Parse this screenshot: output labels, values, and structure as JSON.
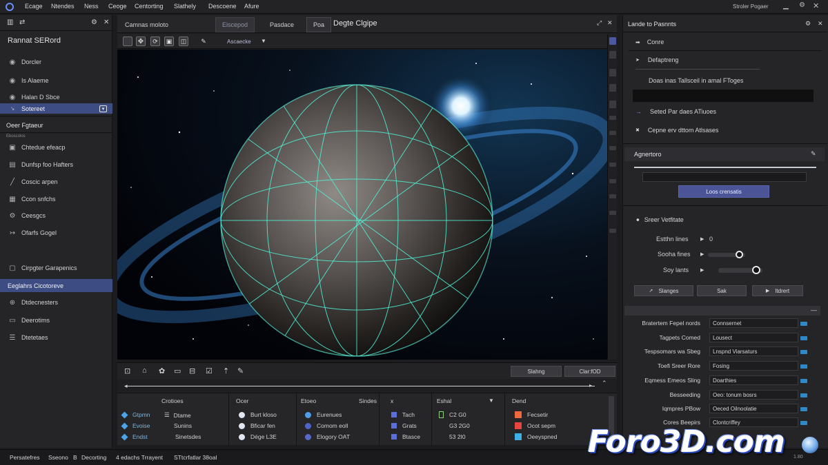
{
  "menubar": {
    "items": [
      "Ecage",
      "Ntendes",
      "Ness",
      "Ceoge",
      "Centorting",
      "Slathely",
      "Descoene",
      "Afure"
    ],
    "right_label": "Stroler Pogaer"
  },
  "left_panel": {
    "title": "Rannat SERord",
    "items_top": [
      {
        "label": "Dorcler",
        "icon": "circle-icon"
      },
      {
        "label": "Is Alaeme",
        "icon": "circle-icon"
      },
      {
        "label": "Halan D Sbce",
        "icon": "circle-icon"
      },
      {
        "label": "Sotereet",
        "icon": "expand-icon"
      }
    ],
    "section": "Oeer Fgtaeur",
    "section_sub": "Eboscolos",
    "items_mid": [
      {
        "label": "Chtedue efeacp",
        "icon": "box-icon"
      },
      {
        "label": "Dunfsp foo Hafters",
        "icon": "layers-icon"
      },
      {
        "label": "Coscic arpen",
        "icon": "line-icon"
      },
      {
        "label": "Ccon snfchs",
        "icon": "grid-icon"
      },
      {
        "label": "Ceesgcs",
        "icon": "gear-icon"
      },
      {
        "label": "Ofarfs Gogel",
        "icon": "arrow-icon"
      },
      {
        "label": "Cirpgter Garapenics",
        "icon": "frame-icon"
      }
    ],
    "selected": "Eeglahrs Cicotoreve",
    "items_bottom": [
      {
        "label": "Dtdecnesters",
        "icon": "globe-icon"
      },
      {
        "label": "Deerotims",
        "icon": "image-icon"
      },
      {
        "label": "Dtetetaes",
        "icon": "list-icon"
      }
    ]
  },
  "viewport": {
    "tabs": [
      "Camnas moloto",
      "Eiscepod",
      "Pasdace",
      "Poa"
    ],
    "title": "Degte Clgipe",
    "mode_label": "Ascaecke"
  },
  "timeline": {
    "btn_left": "Slahng",
    "btn_right": "Clar:fOD",
    "columns": [
      {
        "head": "Crotioes",
        "items": [
          "Gtpmn",
          "Evoise",
          "Endst"
        ],
        "items2": [
          "Dtame",
          "Sunins",
          "Sinetsdes"
        ]
      },
      {
        "head": "Ocer",
        "items": [
          "Burt kloso",
          "Bficar fen",
          "Dége L3E"
        ]
      },
      {
        "head": "Etoeo",
        "head2": "Sindes",
        "items": [
          "Eurenues",
          "Comom eoll",
          "Elogory OAT"
        ]
      },
      {
        "head": "x",
        "items": [
          "Tach",
          "Grats",
          "Btasce"
        ]
      },
      {
        "head": "Eshal",
        "items": [
          "C2 G0",
          "G3 2G0",
          "53 2I0"
        ]
      },
      {
        "head": "Dend",
        "items": [
          "Fecsetir",
          "Ocot sepm",
          "Oeeyspned"
        ]
      }
    ]
  },
  "right_panel": {
    "title": "Lande to Pasnnts",
    "items": [
      "Conre",
      "Defaptreng",
      "Doas inas Tallsceil in amal FToges",
      "Seted Par daes ATiuoes",
      "Cepne erv dttom Atlsases"
    ],
    "section2": "Agnertoro",
    "button_primary": "Loos crensatis",
    "section3": "Sreer Vetfitate",
    "sliders": [
      {
        "label": "Estthn lines",
        "value": "0",
        "level": 0
      },
      {
        "label": "Sooha fines",
        "value": "",
        "level": 0.92
      },
      {
        "label": "Soy lants",
        "value": "",
        "level": 0.95
      }
    ],
    "buttons": [
      "Slanges",
      "Sak",
      "Itdrert"
    ],
    "properties": [
      {
        "label": "Bratertem Fepel nords",
        "value": "Connsernet"
      },
      {
        "label": "Tagpets Comed",
        "value": "Lousect"
      },
      {
        "label": "Tespsomars wa Sbeg",
        "value": "Lnspnd Viarsaturs"
      },
      {
        "label": "Toefi Sreer Rore",
        "value": "Fosing"
      },
      {
        "label": "Eqmess Emeos Sling",
        "value": "Doarthies"
      },
      {
        "label": "Besseeding",
        "value": "Oeo: tonum bosrs"
      },
      {
        "label": "Iqmpres PBow",
        "value": "Oeced Oilnoolatie"
      },
      {
        "label": "Cores Beepirs",
        "value": "Clontcriffey"
      }
    ]
  },
  "status_bar": {
    "items": [
      "Persatefres",
      "Sseono",
      "B",
      "Decorting",
      "4 edachs Trrayent",
      "STtcrfatlar 38oal"
    ],
    "version": "1.80"
  },
  "watermark": "Foro3D.com",
  "colors": {
    "accent": "#4a5496",
    "selection": "#3d4d84",
    "wireframe": "#4ff2d6",
    "chip": "#2f88c8"
  }
}
